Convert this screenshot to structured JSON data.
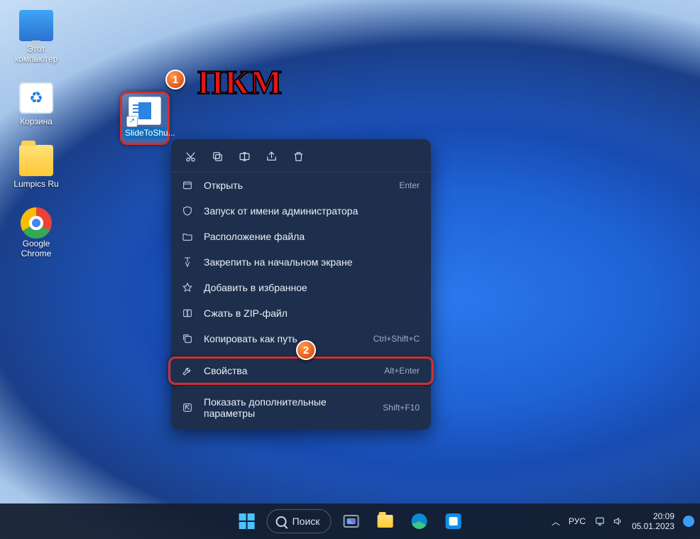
{
  "desktop_icons": {
    "this_pc": "Этот\nкомпьютер",
    "recycle_bin": "Корзина",
    "lumpics": "Lumpics Ru",
    "chrome": "Google\nChrome"
  },
  "shortcut": {
    "label": "SlideToShu..."
  },
  "annotation": {
    "marker1": "1",
    "marker2": "2",
    "rmb": "ПКМ"
  },
  "context_menu": {
    "open": "Открыть",
    "open_shortcut": "Enter",
    "run_as_admin": "Запуск от имени администратора",
    "file_location": "Расположение файла",
    "pin_start": "Закрепить на начальном экране",
    "add_favorite": "Добавить в избранное",
    "compress_zip": "Сжать в ZIP-файл",
    "copy_as_path": "Копировать как путь",
    "copy_shortcut": "Ctrl+Shift+C",
    "properties": "Свойства",
    "properties_shortcut": "Alt+Enter",
    "more_options": "Показать дополнительные параметры",
    "more_options_shortcut": "Shift+F10"
  },
  "taskbar": {
    "search_label": "Поиск",
    "tray_lang": "РУС",
    "clock_time": "20:09",
    "clock_date": "05.01.2023"
  }
}
